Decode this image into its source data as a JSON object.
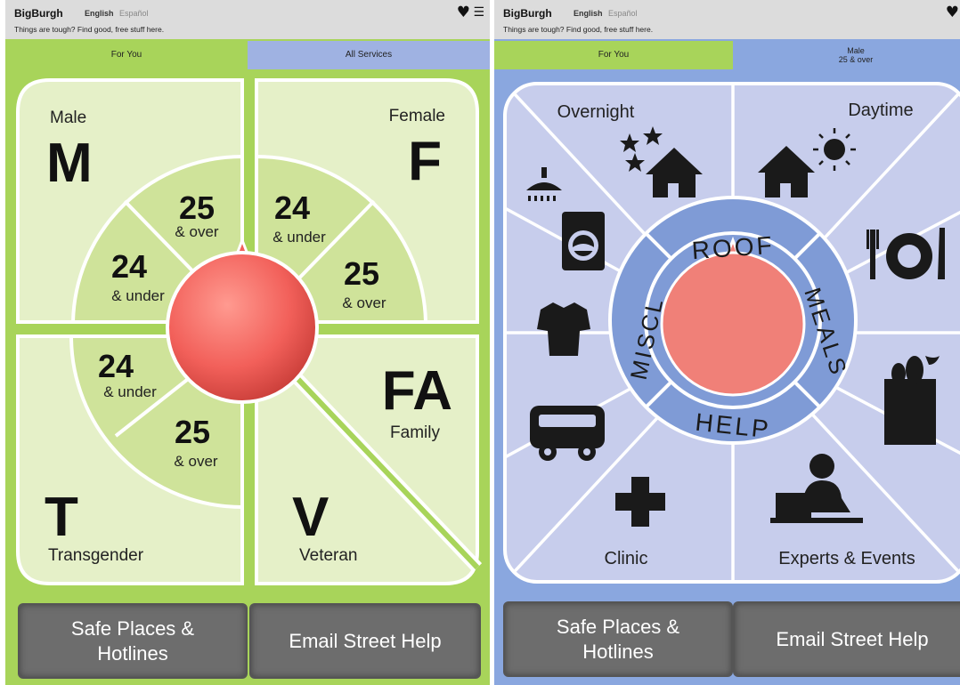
{
  "left": {
    "header": {
      "brand": "BigBurgh",
      "lang_en": "English",
      "lang_es": "Español",
      "tagline": "Things are tough? Find good, free stuff here."
    },
    "tabs": [
      {
        "label": "For You"
      },
      {
        "label": "All Services"
      }
    ],
    "wheel": {
      "male_label": "Male",
      "male_letter": "M",
      "female_label": "Female",
      "female_letter": "F",
      "transgender_label": "Transgender",
      "transgender_letter": "T",
      "veteran_label": "Veteran",
      "veteran_letter": "V",
      "family_label": "Family",
      "family_letter": "FA",
      "male_over_num": "25",
      "male_over_txt": "& over",
      "male_under_num": "24",
      "male_under_txt": "& under",
      "female_under_num": "24",
      "female_under_txt": "& under",
      "female_over_num": "25",
      "female_over_txt": "& over",
      "trans_under_num": "24",
      "trans_under_txt": "& under",
      "trans_over_num": "25",
      "trans_over_txt": "& over"
    },
    "footer": {
      "safe_places_line1": "Safe Places &",
      "safe_places_line2": "Hotlines",
      "email_help": "Email Street Help"
    }
  },
  "right": {
    "header": {
      "brand": "BigBurgh",
      "lang_en": "English",
      "lang_es": "Español",
      "tagline": "Things are tough? Find good, free stuff here."
    },
    "tabs": [
      {
        "label": "For You"
      },
      {
        "label_line1": "Male",
        "label_line2": "25 & over"
      }
    ],
    "wheel": {
      "overnight": "Overnight",
      "daytime": "Daytime",
      "clinic": "Clinic",
      "experts_events": "Experts & Events",
      "roof": "ROOF",
      "meals": "MEALS",
      "help": "HELP",
      "miscl": "MISCL"
    },
    "icons": [
      "stars-icon",
      "house-icon",
      "sun-icon",
      "shower-icon",
      "washing-machine-icon",
      "plate-icon",
      "tshirt-icon",
      "grocery-bag-icon",
      "bus-icon",
      "medical-cross-icon",
      "person-desk-icon"
    ],
    "footer": {
      "safe_places_line1": "Safe Places &",
      "safe_places_line2": "Hotlines",
      "email_help": "Email Street Help"
    }
  },
  "colors": {
    "green_bg": "#a8d45a",
    "green_panel": "#e5f0c8",
    "green_wedge": "#cfe39a",
    "blue_bg": "#8aa7df",
    "blue_panel": "#c7cdec",
    "ring_blue": "#7f9bd6",
    "dial_red": "#f2706a",
    "button_gray": "#6d6d6d"
  }
}
